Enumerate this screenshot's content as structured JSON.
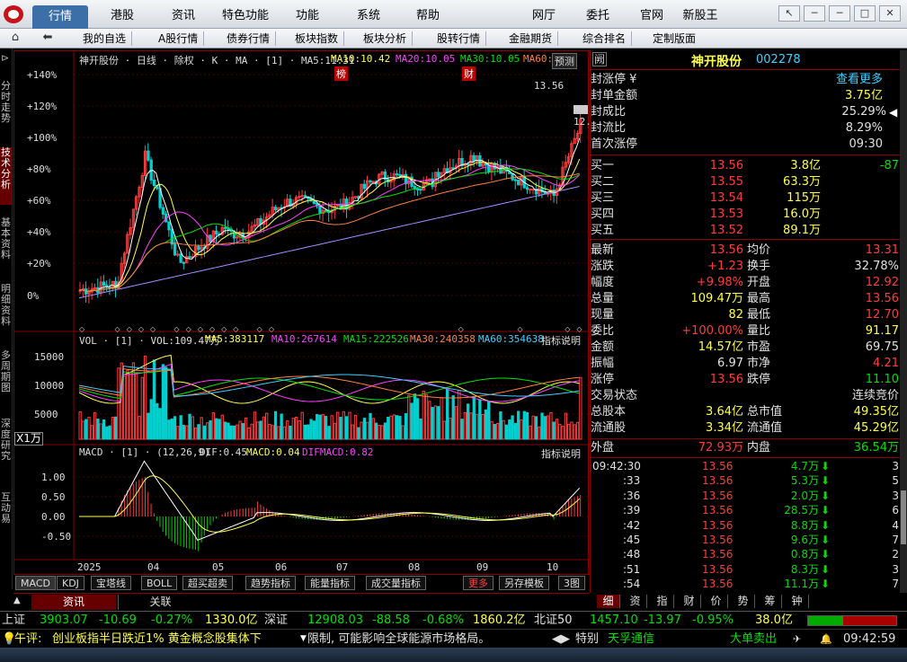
{
  "menu": {
    "tabs": [
      "行情",
      "港股",
      "资讯",
      "特色功能",
      "功能",
      "系统",
      "帮助"
    ],
    "right": [
      "网厅",
      "委托",
      "官网",
      "新股王"
    ]
  },
  "nav": {
    "items": [
      "我的自选",
      "A股行情",
      "债券行情",
      "板块指数",
      "板块分析",
      "股转行情",
      "金融期货",
      "综合排名",
      "定制版面"
    ]
  },
  "side": {
    "items": [
      "分时走势",
      "技术分析",
      "基本资料",
      "明细资料",
      "多周期图",
      "深度研究",
      "互动易"
    ]
  },
  "kline": {
    "header": "神开股份 · 日线 · 除权 · K · MA · [1] · MA5:11.31",
    "ma10": "MA10:10.42",
    "ma20": "MA20:10.05",
    "ma30": "MA30:10.05",
    "ma60": "MA60:",
    "btn": "预测",
    "flag1": "榜",
    "flag2": "财",
    "price_hi": "13.56",
    "price_lo": "12.",
    "yticks": [
      "+140%",
      "+120%",
      "+100%",
      "+80%",
      "+60%",
      "+40%",
      "+20%",
      "0%"
    ]
  },
  "vol": {
    "header": "VOL · [1] · VOL:109.47万",
    "ma5": "MA5:383117",
    "ma10": "MA10:267614",
    "ma15": "MA15:222526",
    "ma30": "MA30:240358",
    "ma60": "MA60:354638",
    "btn": "指标说明",
    "yticks": [
      "15000",
      "10000",
      "5000"
    ],
    "unit": "X1万"
  },
  "macd": {
    "header": "MACD · [1] · (12,26,9)",
    "dif": "DIF:0.45",
    "macd": "MACD:0.04",
    "difmacd": "DIFMACD:0.82",
    "btn": "指标说明",
    "yticks": [
      "1.00",
      "0.50",
      "0.00",
      "-0.50"
    ]
  },
  "xaxis": [
    "2025",
    "04",
    "05",
    "06",
    "07",
    "08",
    "09",
    "10"
  ],
  "btabs": [
    "MACD",
    "KDJ",
    "宝塔线",
    "BOLL",
    "超买超卖",
    "趋势指标",
    "能量指标",
    "成交量指标"
  ],
  "btabs_right": [
    "更多",
    "另存模板",
    "3图"
  ],
  "infotabs": [
    "资讯",
    "关联"
  ],
  "stock": {
    "icon": "阙",
    "name": "神开股份",
    "code": "002278"
  },
  "seal": [
    {
      "k": "封涨停 ¥",
      "v": "查看更多"
    },
    {
      "k": "封单金额",
      "v": "3.75亿"
    },
    {
      "k": "封成比",
      "v": "25.29%"
    },
    {
      "k": "封流比",
      "v": "8.29%"
    },
    {
      "k": "首次涨停",
      "v": "09:30"
    }
  ],
  "asks": [
    {
      "k": "买一",
      "p": "13.56",
      "q": "3.8亿",
      "c": "-87"
    },
    {
      "k": "买二",
      "p": "13.55",
      "q": "63.3万",
      "c": ""
    },
    {
      "k": "买三",
      "p": "13.54",
      "q": "115万",
      "c": ""
    },
    {
      "k": "买四",
      "p": "13.53",
      "q": "16.0万",
      "c": ""
    },
    {
      "k": "买五",
      "p": "13.52",
      "q": "89.1万",
      "c": ""
    }
  ],
  "quote": [
    {
      "k1": "最新",
      "v1": "13.56",
      "k2": "均价",
      "v2": "13.31"
    },
    {
      "k1": "涨跌",
      "v1": "+1.23",
      "k2": "换手",
      "v2": "32.78%"
    },
    {
      "k1": "幅度",
      "v1": "+9.98%",
      "k2": "开盘",
      "v2": "12.92"
    },
    {
      "k1": "总量",
      "v1": "109.47万",
      "k2": "最高",
      "v2": "13.56"
    },
    {
      "k1": "现量",
      "v1": "82",
      "k2": "最低",
      "v2": "12.70"
    },
    {
      "k1": "委比",
      "v1": "+100.00%",
      "k2": "量比",
      "v2": "91.17"
    },
    {
      "k1": "金额",
      "v1": "14.57亿",
      "k2": "市盈",
      "v2": "69.75"
    },
    {
      "k1": "振幅",
      "v1": "6.97",
      "k2": "市净",
      "v2": "4.21"
    },
    {
      "k1": "涨停",
      "v1": "13.56",
      "k2": "跌停",
      "v2": "11.10"
    }
  ],
  "trade_state": {
    "k": "交易状态",
    "v": "连续竞价"
  },
  "shares": [
    {
      "k1": "总股本",
      "v1": "3.64亿",
      "k2": "总市值",
      "v2": "49.35亿"
    },
    {
      "k1": "流通股",
      "v1": "3.34亿",
      "k2": "流通值",
      "v2": "45.29亿"
    }
  ],
  "outer": {
    "k1": "外盘",
    "v1": "72.93万",
    "k2": "内盘",
    "v2": "36.54万"
  },
  "ticks": [
    {
      "t": "09:42:30",
      "p": "13.56",
      "q": "4.7万",
      "n": "3"
    },
    {
      "t": ":33",
      "p": "13.56",
      "q": "5.3万",
      "n": "5"
    },
    {
      "t": ":36",
      "p": "13.56",
      "q": "2.0万",
      "n": "3"
    },
    {
      "t": ":39",
      "p": "13.56",
      "q": "28.5万",
      "n": "6"
    },
    {
      "t": ":42",
      "p": "13.56",
      "q": "8.8万",
      "n": "4"
    },
    {
      "t": ":45",
      "p": "13.56",
      "q": "9.6万",
      "n": "7"
    },
    {
      "t": ":48",
      "p": "13.56",
      "q": "0.8万",
      "n": "2"
    },
    {
      "t": ":51",
      "p": "13.56",
      "q": "8.3万",
      "n": "3"
    },
    {
      "t": ":54",
      "p": "13.56",
      "q": "11.1万",
      "n": "7"
    }
  ],
  "vtabs": [
    "细",
    "资",
    "指",
    "财",
    "价",
    "势",
    "筹",
    "钟"
  ],
  "status": {
    "sh": "上证",
    "sh_v": "3903.07",
    "sh_c": "-10.69",
    "sh_p": "-0.27%",
    "sh_a": "1330.0亿",
    "sz": "深证",
    "sz_v": "12908.03",
    "sz_c": "-88.58",
    "sz_p": "-0.68%",
    "sz_a": "1860.2亿",
    "bz": "北证50",
    "bz_v": "1457.10",
    "bz_c": "-13.97",
    "bz_p": "-0.95%",
    "bz_a": "38.0亿"
  },
  "news": {
    "tag": "午评:",
    "text": "创业板指半日跌近1%  黄金概念股集体下",
    "text2": "限制, 可能影响全球能源市场格局。",
    "btn": "特别",
    "brand": "天孚通信",
    "alert": "大单卖出",
    "time": "09:42:59"
  }
}
